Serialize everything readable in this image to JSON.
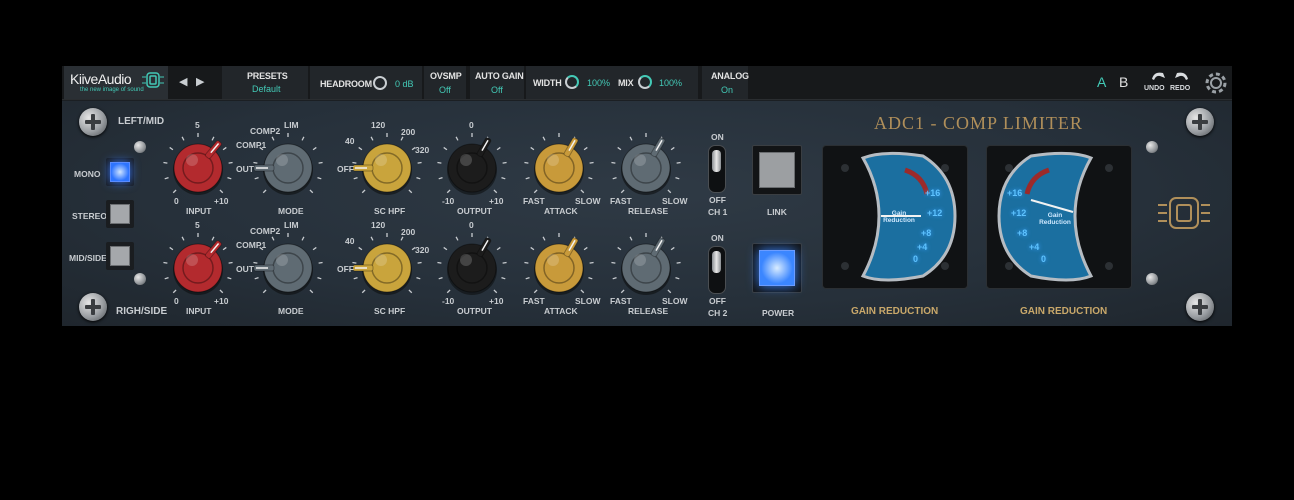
{
  "topbar": {
    "brand": "KiiveAudio",
    "tagline": "the new image of sound",
    "presets_label": "PRESETS",
    "presets_value": "Default",
    "headroom_label": "HEADROOM",
    "headroom_value": "0 dB",
    "ovsmp_label": "OVSMP",
    "ovsmp_value": "Off",
    "autogain_label": "AUTO GAIN",
    "autogain_value": "Off",
    "width_label": "WIDTH",
    "width_value": "100%",
    "mix_label": "MIX",
    "mix_value": "100%",
    "analog_label": "ANALOG",
    "analog_value": "On",
    "ab_a": "A",
    "ab_b": "B",
    "undo_label": "UNDO",
    "redo_label": "REDO"
  },
  "panel": {
    "title": "ADC1 - COMP  LIMITER",
    "left_mid": "LEFT/MID",
    "righ_side": "RIGH/SIDE",
    "mode_buttons": [
      {
        "label": "MONO",
        "active": true
      },
      {
        "label": "STEREO",
        "active": false
      },
      {
        "label": "MID/SIDE",
        "active": false
      }
    ],
    "channels": [
      {
        "input": {
          "label": "INPUT",
          "top": "5",
          "min": "0",
          "max": "+10"
        },
        "mode": {
          "label": "MODE",
          "out": "OUT",
          "comp1": "COMP1",
          "comp2": "COMP2",
          "lim": "LIM"
        },
        "schpf": {
          "label": "SC HPF",
          "off": "OFF",
          "t40": "40",
          "t120": "120",
          "t200": "200",
          "t320": "320"
        },
        "output": {
          "label": "OUTPUT",
          "top": "0",
          "min": "-10",
          "max": "+10"
        },
        "attack": {
          "label": "ATTACK",
          "fast": "FAST",
          "slow": "SLOW"
        },
        "release": {
          "label": "RELEASE",
          "fast": "FAST",
          "slow": "SLOW"
        },
        "switch": {
          "on": "ON",
          "off": "OFF",
          "ch": "CH 1"
        }
      },
      {
        "input": {
          "label": "INPUT",
          "top": "5",
          "min": "0",
          "max": "+10"
        },
        "mode": {
          "label": "MODE",
          "out": "OUT",
          "comp1": "COMP1",
          "comp2": "COMP2",
          "lim": "LIM"
        },
        "schpf": {
          "label": "SC HPF",
          "off": "OFF",
          "t40": "40",
          "t120": "120",
          "t200": "200",
          "t320": "320"
        },
        "output": {
          "label": "OUTPUT",
          "top": "0",
          "min": "-10",
          "max": "+10"
        },
        "attack": {
          "label": "ATTACK",
          "fast": "FAST",
          "slow": "SLOW"
        },
        "release": {
          "label": "RELEASE",
          "fast": "FAST",
          "slow": "SLOW"
        },
        "switch": {
          "on": "ON",
          "off": "OFF",
          "ch": "CH 2"
        }
      }
    ],
    "link_label": "LINK",
    "power_label": "POWER",
    "meters": [
      {
        "label": "GAIN REDUCTION",
        "caption": "Gain Reduction",
        "ticks": [
          "+16",
          "+12",
          "+8",
          "+4",
          "0"
        ]
      },
      {
        "label": "GAIN REDUCTION",
        "caption": "Gain Reduction",
        "ticks": [
          "+16",
          "+12",
          "+8",
          "+4",
          "0"
        ]
      }
    ]
  },
  "colors": {
    "accent": "#43c9b6",
    "knob_red": "#b32a2e",
    "knob_grey": "#5f6b73",
    "knob_yellow": "#c9a43c",
    "knob_black": "#1c1c1c",
    "knob_amber": "#c89a3a",
    "label_gold": "#c9a86a",
    "led_blue": "#3b86ff"
  }
}
